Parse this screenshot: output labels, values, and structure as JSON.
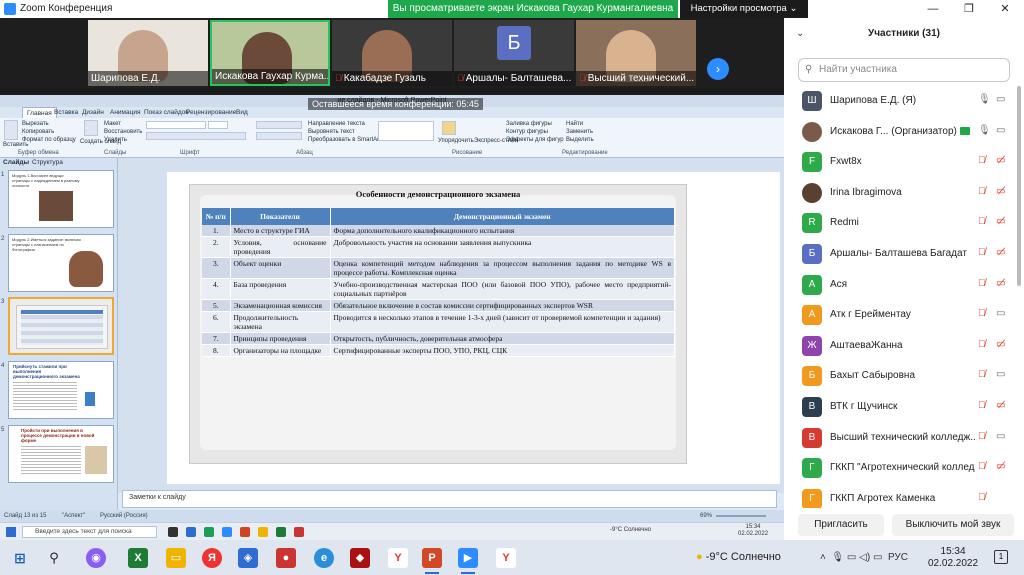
{
  "titlebar": {
    "app_title": "Zoom Конференция",
    "share_banner": "Вы просматриваете экран Искакова Гаухар Курмангалиевна",
    "view_settings": "Настройки просмотра",
    "minimize": "—",
    "restore": "❐",
    "close": "✕"
  },
  "videos": [
    {
      "name": "Шарипова Е.Д.",
      "muted": false
    },
    {
      "name": "Искакова Гаухар Курма...",
      "muted": false
    },
    {
      "name": "Какабадзе Гузаль",
      "muted": true
    },
    {
      "name": "Аршалы- Балташева...",
      "muted": true,
      "initial": "Б"
    },
    {
      "name": "Высший технический...",
      "muted": true
    }
  ],
  "remaining_time": "Оставшееся время конференции: 05:45",
  "ppt": {
    "window_title": "ие слайдов - Microsoft PowerPoint",
    "tabs": [
      "Главная",
      "Вставка",
      "Дизайн",
      "Анимация",
      "Показ слайдов",
      "Рецензирование",
      "Вид"
    ],
    "ribbon": {
      "paste": "Вставить",
      "cut": "Вырезать",
      "copy": "Копировать",
      "format_painter": "Формат по образцу",
      "new_slide": "Создать слайд",
      "layout": "Макет",
      "reset": "Восстановить",
      "delete": "Удалить",
      "find": "Найти",
      "replace": "Заменить",
      "select": "Выделить",
      "text_direction": "Направление текста",
      "align_text": "Выровнять текст",
      "smartart": "Преобразовать в SmartArt",
      "arrange": "Упорядочить",
      "quick_styles": "Экспресс-стили",
      "shape_fill": "Заливка фигуры",
      "shape_outline": "Контур фигуры",
      "shape_effects": "Эффекты для фигур",
      "groups": [
        "Буфер обмена",
        "Слайды",
        "Шрифт",
        "Абзац",
        "Рисование",
        "Редактирование"
      ]
    },
    "pane_tabs": [
      "Слайды",
      "Структура"
    ],
    "thumbs": [
      {
        "num": "1",
        "text": "Модуль 1.Висчисен ведущи страницы с надеждением в разному личности"
      },
      {
        "num": "2",
        "text": "Модуль 2.Иметься задание: включая страницы с назначением по Фотографии"
      },
      {
        "num": "3",
        "text": ""
      },
      {
        "num": "4",
        "text": "Прийснуть стажили при выполнения демонстрационного экзамена"
      },
      {
        "num": "5",
        "text": "Пройсти при выполнения в процессе демонстрации в новой форме"
      }
    ],
    "notes_placeholder": "Заметки к слайду",
    "status": {
      "slide": "Слайд 13 из 15",
      "theme": "\"Аспект\"",
      "lang": "Русский (Россия)",
      "zoom": "69%"
    }
  },
  "slide": {
    "title": "Особенности демонстрационного экзамена",
    "headers": [
      "№ п/п",
      "Показатели",
      "Демонстрационный экзамен"
    ],
    "rows": [
      {
        "n": "1.",
        "ind": "Место в структуре ГИА",
        "val": "Форма дополнительного квалификационного испытания"
      },
      {
        "n": "2.",
        "ind": "Условия, основание проведения",
        "val": "Добровольность участия на основании заявления выпускника"
      },
      {
        "n": "3.",
        "ind": "Объект оценки",
        "val": "Оценка компетенций методом наблюдения за процессом выполнения задания по методике WS в процессе работы. Комплексная оценка"
      },
      {
        "n": "4.",
        "ind": "База проведения",
        "val": "Учебно-производственная мастерская ПОО (или базовой ПОО УПО), рабочее место предприятий-социальных партнёров"
      },
      {
        "n": "5.",
        "ind": "Экзаменационная комиссия",
        "val": "Обязательное включение в состав комиссии сертифицированных экспертов WSR"
      },
      {
        "n": "6.",
        "ind": "Продолжительность экзамена",
        "val": "Проводится в несколько этапов в течение 1-3-х дней (зависит от проверяемой компетенции и задания)"
      },
      {
        "n": "7.",
        "ind": "Принципы проведения",
        "val": "Открытость, публичность, доверительная атмосфера"
      },
      {
        "n": "8.",
        "ind": "Организаторы на площадке",
        "val": "Сертифицированные эксперты ПОО, УПО, РКЦ, СЦК"
      }
    ]
  },
  "inner_taskbar": {
    "search": "Введите здесь текст для поиска",
    "weather": "-9°С Солнечно",
    "time": "15:34",
    "date": "02.02.2022"
  },
  "participants": {
    "header": "Участники (31)",
    "search_placeholder": "Найти участника",
    "list": [
      {
        "initial": "Ш",
        "color": "#4a5568",
        "name": "Шарипова Е.Д. (Я)",
        "mic": "on",
        "cam": "on"
      },
      {
        "initial": "",
        "color": "#7a5a48",
        "photo": true,
        "name": "Искакова Г... (Организатор)",
        "host": true,
        "mic": "on",
        "cam": "on"
      },
      {
        "initial": "F",
        "color": "#2eaa4b",
        "name": "Fxwt8x",
        "mic": "off",
        "cam": "off"
      },
      {
        "initial": "",
        "color": "#5a4030",
        "photo": true,
        "name": "Irina Ibragimova",
        "mic": "off",
        "cam": "off"
      },
      {
        "initial": "R",
        "color": "#2eaa4b",
        "name": "Redmi",
        "mic": "off",
        "cam": "off"
      },
      {
        "initial": "Б",
        "color": "#5a6fc2",
        "name": "Аршалы- Балташева Багадат",
        "mic": "off",
        "cam": "off"
      },
      {
        "initial": "А",
        "color": "#2eaa4b",
        "name": "Ася",
        "mic": "off",
        "cam": "off"
      },
      {
        "initial": "А",
        "color": "#f29a1e",
        "name": "Атк г Ерейментау",
        "mic": "off",
        "cam": "on"
      },
      {
        "initial": "Ж",
        "color": "#8e44ad",
        "name": "АштаеваЖанна",
        "mic": "off",
        "cam": "off"
      },
      {
        "initial": "Б",
        "color": "#f29a1e",
        "name": "Бахыт Сабыровна",
        "mic": "off",
        "cam": "on"
      },
      {
        "initial": "В",
        "color": "#2c3e50",
        "name": "ВТК г Щучинск",
        "mic": "off",
        "cam": "off"
      },
      {
        "initial": "В",
        "color": "#d63b2f",
        "name": "Высший технический колледж...",
        "mic": "off",
        "cam": "on"
      },
      {
        "initial": "Г",
        "color": "#2eaa4b",
        "name": "ГККП \"Агротехнический колледж...",
        "mic": "off",
        "cam": "off"
      },
      {
        "initial": "Г",
        "color": "#f29a1e",
        "name": "ГККП Агротех Каменка",
        "mic": "off",
        "cam": "none"
      }
    ],
    "invite": "Пригласить",
    "mute_all": "Выключить мой звук"
  },
  "taskbar": {
    "weather": "-9°C Солнечно",
    "lang": "РУС",
    "time": "15:34",
    "date": "02.02.2022",
    "notify": "1"
  }
}
